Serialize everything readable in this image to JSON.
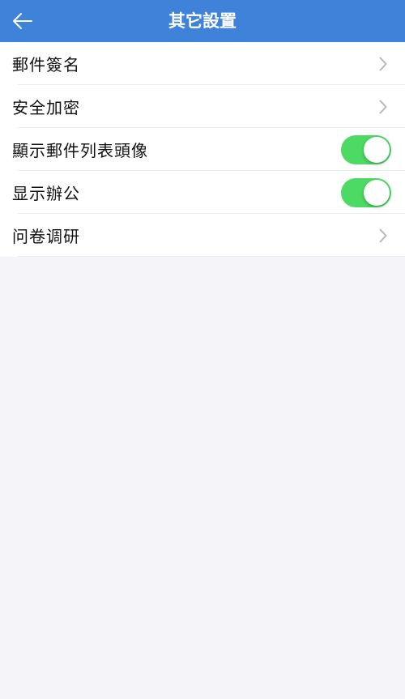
{
  "header": {
    "title": "其它設置"
  },
  "colors": {
    "header_bg": "#3e82d9",
    "toggle_on": "#4cd964",
    "background": "#f5f4f8"
  },
  "settings": [
    {
      "label": "郵件簽名",
      "control": "chevron-right-icon"
    },
    {
      "label": "安全加密",
      "control": "chevron-right-icon"
    },
    {
      "label": "顯示郵件列表頭像",
      "control": "toggle",
      "on": true
    },
    {
      "label": "显示辦公",
      "control": "toggle",
      "on": true
    },
    {
      "label": "问卷调研",
      "control": "chevron-right-icon"
    }
  ]
}
